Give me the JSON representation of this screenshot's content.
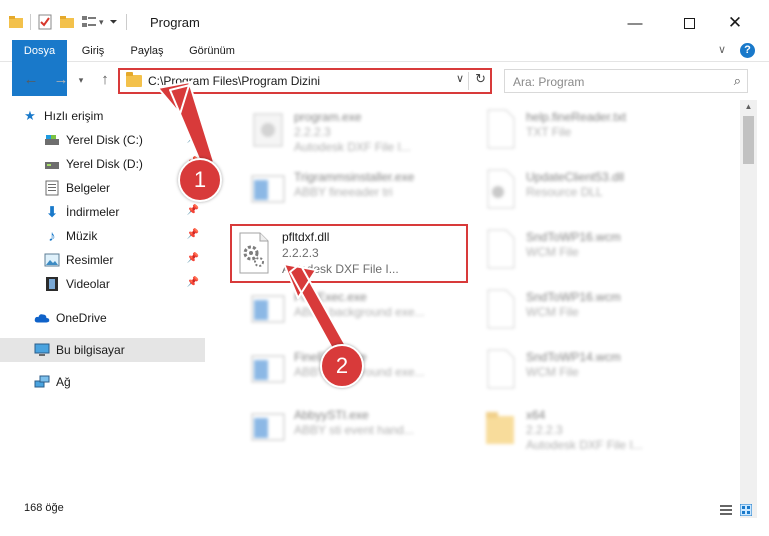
{
  "window": {
    "title": "Program",
    "minimize_icon": "minimize-icon",
    "maximize_icon": "maximize-icon",
    "close_icon": "close-icon"
  },
  "ribbon": {
    "tabs": [
      "Dosya",
      "Giriş",
      "Paylaş",
      "Görünüm"
    ],
    "help": "?",
    "chevron": "∨"
  },
  "address": {
    "path": "C:\\Program Files\\Program Dizini",
    "search_placeholder": "Ara: Program"
  },
  "sidebar": {
    "items": [
      {
        "label": "Hızlı erişim",
        "icon": "star-icon",
        "pinned": false
      },
      {
        "label": "Yerel Disk (C:)",
        "icon": "drive-icon",
        "pinned": true
      },
      {
        "label": "Yerel Disk (D:)",
        "icon": "drive-icon",
        "pinned": true
      },
      {
        "label": "Belgeler",
        "icon": "documents-icon",
        "pinned": true
      },
      {
        "label": "İndirmeler",
        "icon": "download-icon",
        "pinned": true
      },
      {
        "label": "Müzik",
        "icon": "music-icon",
        "pinned": true
      },
      {
        "label": "Resimler",
        "icon": "pictures-icon",
        "pinned": true
      },
      {
        "label": "Videolar",
        "icon": "video-icon",
        "pinned": true
      },
      {
        "label": "OneDrive",
        "icon": "cloud-icon",
        "pinned": false
      },
      {
        "label": "Bu bilgisayar",
        "icon": "computer-icon",
        "pinned": false
      },
      {
        "label": "Ağ",
        "icon": "network-icon",
        "pinned": false
      }
    ]
  },
  "files": {
    "col1": [
      {
        "name": "program.exe",
        "line2": "2.2.2.3",
        "line3": "Autodesk DXF File I..."
      },
      {
        "name": "Trigrammsinstaller.exe",
        "line2": "ABBY fineeader tri",
        "line3": ""
      },
      {
        "name": "pfltdxf.dll",
        "line2": "2.2.2.3",
        "line3": "Autodesk DXF File I..."
      },
      {
        "name": "FineExec.exe",
        "line2": "ABBY background exe...",
        "line3": ""
      },
      {
        "name": "FineExec.exe",
        "line2": "ABBY background exe...",
        "line3": ""
      },
      {
        "name": "AbbyySTI.exe",
        "line2": "ABBY sti event hand...",
        "line3": ""
      }
    ],
    "col2": [
      {
        "name": "help.fineReader.txt",
        "line2": "TXT File",
        "line3": ""
      },
      {
        "name": "UpdateClient53.dll",
        "line2": "Resource DLL",
        "line3": ""
      },
      {
        "name": "SndToWP16.wcm",
        "line2": "WCM File",
        "line3": ""
      },
      {
        "name": "SndToWP16.wcm",
        "line2": "WCM File",
        "line3": ""
      },
      {
        "name": "SndToWP14.wcm",
        "line2": "WCM File",
        "line3": ""
      },
      {
        "name": "x64",
        "line2": "2.2.2.3",
        "line3": "Autodesk DXF File I..."
      }
    ]
  },
  "status": {
    "count": "168 öğe"
  },
  "callouts": [
    "1",
    "2"
  ],
  "colors": {
    "accent": "#1979ca",
    "highlight_red": "#d83a3a",
    "selected_nav": "#e5e5e5"
  }
}
